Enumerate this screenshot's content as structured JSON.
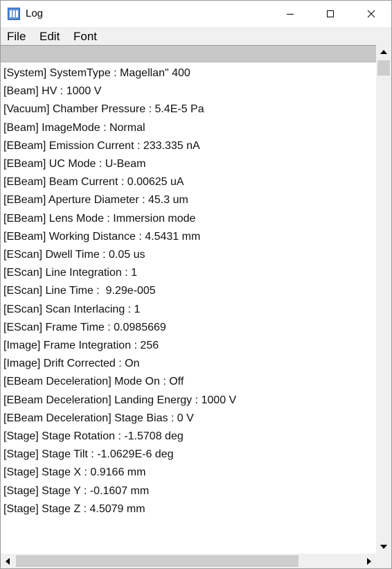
{
  "window": {
    "title": "Log"
  },
  "menu": {
    "file": "File",
    "edit": "Edit",
    "font": "Font"
  },
  "log_lines": [
    "[System] SystemType : Magellan\" 400",
    "[Beam] HV : 1000 V",
    "[Vacuum] Chamber Pressure : 5.4E-5 Pa",
    "[Beam] ImageMode : Normal",
    "[EBeam] Emission Current : 233.335 nA",
    "[EBeam] UC Mode : U-Beam",
    "[EBeam] Beam Current : 0.00625 uA",
    "[EBeam] Aperture Diameter : 45.3 um",
    "[EBeam] Lens Mode : Immersion mode",
    "[EBeam] Working Distance : 4.5431 mm",
    "[EScan] Dwell Time : 0.05 us",
    "[EScan] Line Integration : 1",
    "[EScan] Line Time :  9.29e-005",
    "[EScan] Scan Interlacing : 1",
    "[EScan] Frame Time : 0.0985669",
    "[Image] Frame Integration : 256",
    "[Image] Drift Corrected : On",
    "[EBeam Deceleration] Mode On : Off",
    "[EBeam Deceleration] Landing Energy : 1000 V",
    "[EBeam Deceleration] Stage Bias : 0 V",
    "[Stage] Stage Rotation : -1.5708 deg",
    "[Stage] Stage Tilt : -1.0629E-6 deg",
    "[Stage] Stage X : 0.9166 mm",
    "[Stage] Stage Y : -0.1607 mm",
    "[Stage] Stage Z : 4.5079 mm"
  ],
  "icons": {
    "app": "app-icon",
    "minimize": "minimize-icon",
    "maximize": "maximize-icon",
    "close": "close-icon",
    "scroll_up": "arrow-up-icon",
    "scroll_down": "arrow-down-icon",
    "scroll_left": "arrow-left-icon",
    "scroll_right": "arrow-right-icon"
  }
}
